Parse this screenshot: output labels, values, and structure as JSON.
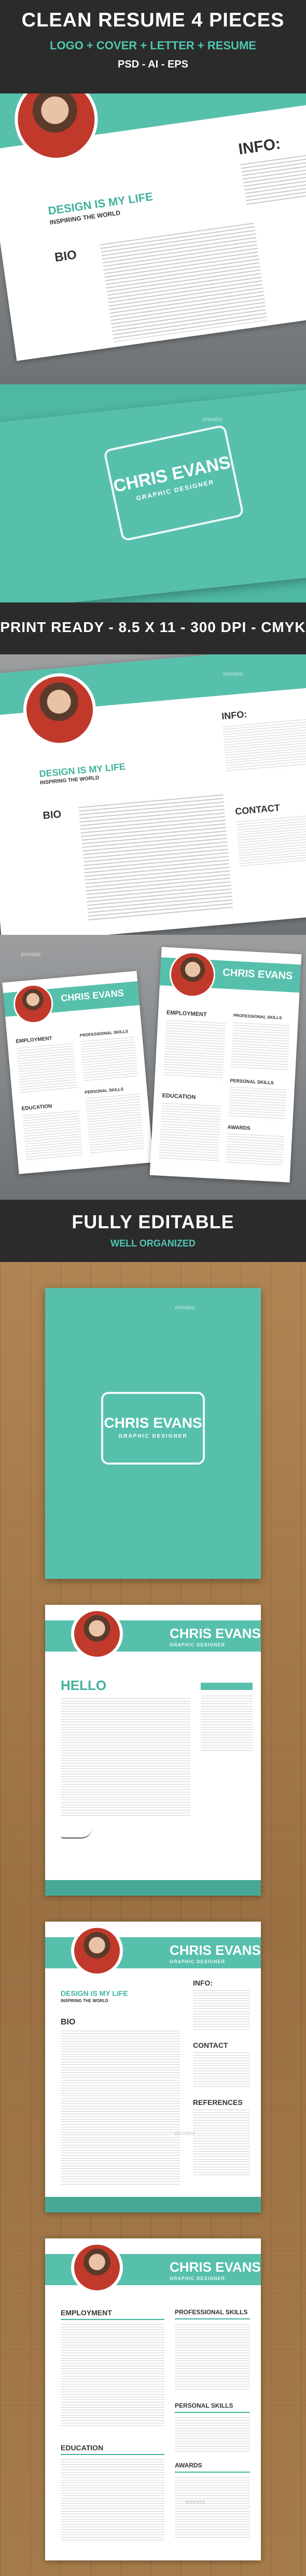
{
  "header": {
    "title": "CLEAN RESUME 4 PIECES",
    "subtitle": "LOGO + COVER + LETTER + RESUME",
    "formats": "PSD - AI - EPS"
  },
  "print_bar": {
    "text": "PRINT READY - 8.5 X 11 - 300 DPI - CMYK"
  },
  "editable_bar": {
    "title": "FULLY EDITABLE",
    "subtitle": "WELL ORGANIZED"
  },
  "watermark": "envato",
  "resume": {
    "name": "CHRIS EVANS",
    "role": "GRAPHIC DESIGNER",
    "tagline": "DESIGN IS MY LIFE",
    "tagline_sub": "INSPIRING THE WORLD",
    "greeting": "HELLO",
    "sections": {
      "bio": "BIO",
      "info": "INFO:",
      "contact": "CONTACT",
      "references": "REFERENCES",
      "employment": "EMPLOYMENT",
      "education": "EDUCATION",
      "professional_skills": "PROFESSIONAL SKILLS",
      "personal_skills": "PERSONAL SKILLS",
      "awards": "AWARDS"
    }
  },
  "colors": {
    "accent": "#57c0ad",
    "dark": "#2b2b2b",
    "wood": "#a57a4a"
  }
}
